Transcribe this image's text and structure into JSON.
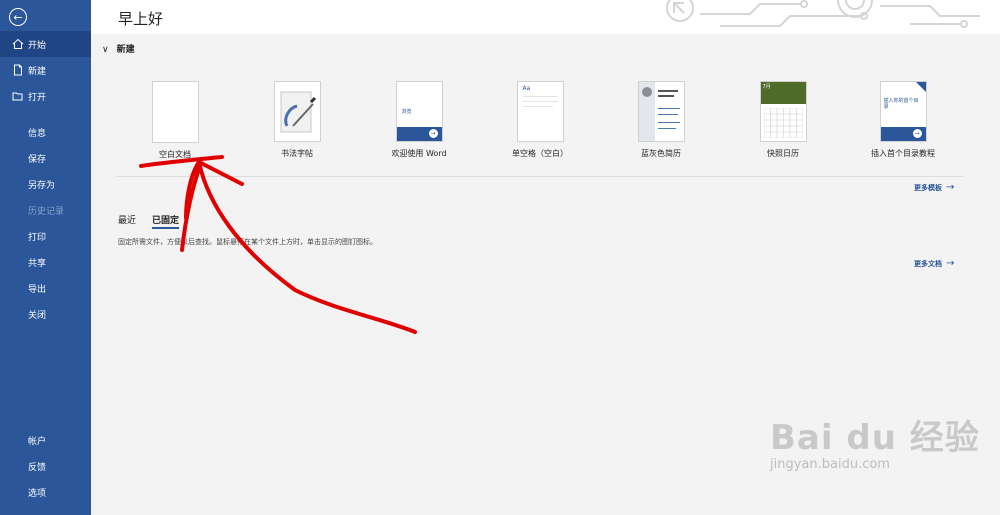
{
  "greeting": "早上好",
  "sidebar": {
    "back_icon": "back-arrow-icon",
    "items": [
      {
        "label": "开始",
        "icon": "home-icon",
        "active": true
      },
      {
        "label": "新建",
        "icon": "new-doc-icon"
      },
      {
        "label": "打开",
        "icon": "folder-icon"
      },
      {
        "label": "信息"
      },
      {
        "label": "保存"
      },
      {
        "label": "另存为"
      },
      {
        "label": "历史记录",
        "disabled": true
      },
      {
        "label": "打印"
      },
      {
        "label": "共享"
      },
      {
        "label": "导出"
      },
      {
        "label": "关闭"
      },
      {
        "label": "帐户"
      },
      {
        "label": "反馈"
      },
      {
        "label": "选项"
      }
    ]
  },
  "new_section": {
    "title": "新建",
    "templates": [
      {
        "label": "空白文档"
      },
      {
        "label": "书法字帖"
      },
      {
        "label": "欢迎使用 Word",
        "thumb_text": "浏览"
      },
      {
        "label": "单空格（空白）",
        "thumb_text": "Aa"
      },
      {
        "label": "蓝灰色简历"
      },
      {
        "label": "快照日历",
        "thumb_text": "7月"
      },
      {
        "label": "插入首个目录教程",
        "thumb_text": "插入你的首个目录"
      }
    ],
    "more_templates": "更多模板"
  },
  "recent": {
    "tabs": [
      {
        "label": "最近",
        "active": false
      },
      {
        "label": "已固定",
        "active": true
      }
    ],
    "hint": "固定所需文件，方便以后查找。鼠标悬停在某个文件上方时，单击显示的图钉图标。",
    "more_docs": "更多文档"
  },
  "colors": {
    "sidebar": "#2b579a",
    "annotation": "#e00000",
    "accent": "#2b579a"
  },
  "watermark": {
    "logo": "Bai du 经验",
    "url": "jingyan.baidu.com"
  }
}
